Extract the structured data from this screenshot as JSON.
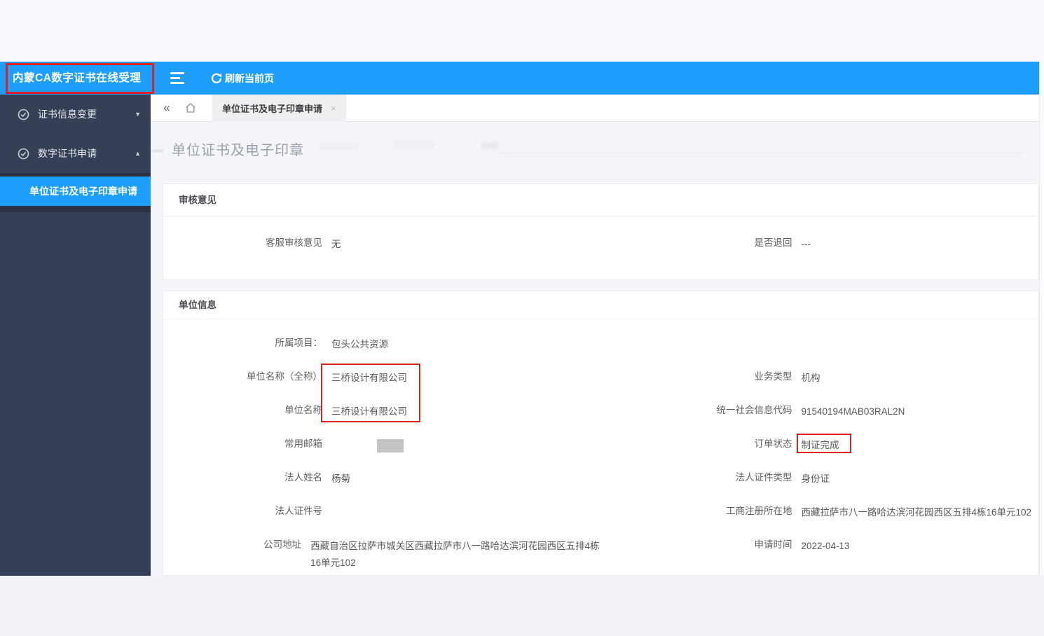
{
  "colors": {
    "accent_blue": "#1e9fff",
    "sidebar_navy": "#353f55",
    "annotation_red": "#dd2020"
  },
  "topbar": {
    "brand": "内蒙CA数字证书在线受理",
    "refresh_label": "刷新当前页"
  },
  "sidebar": {
    "items": [
      {
        "label": "证书信息变更",
        "arrow": "▼",
        "icon": "certificate-check-icon"
      },
      {
        "label": "数字证书申请",
        "arrow": "▲",
        "icon": "certificate-check-icon"
      }
    ],
    "active_subitem": "单位证书及电子印章申请"
  },
  "tabbar": {
    "collapse_glyph": "«",
    "tab_label": "单位证书及电子印章申请",
    "close_glyph": "×"
  },
  "page": {
    "title": "单位证书及电子印章"
  },
  "review_section": {
    "title": "审核意见",
    "fields": [
      {
        "label": "客服审核意见",
        "value": "无"
      },
      {
        "label": "是否退回",
        "value": "---"
      }
    ]
  },
  "unit_section": {
    "title": "单位信息",
    "rows": [
      {
        "left": {
          "label": "所属项目：",
          "value": "包头公共资源"
        },
        "right": {
          "label": "",
          "value": ""
        }
      },
      {
        "left": {
          "label": "单位名称（全称）",
          "value": "三桥设计有限公司"
        },
        "right": {
          "label": "业务类型",
          "value": "机构"
        }
      },
      {
        "left": {
          "label": "单位名称",
          "value": "三桥设计有限公司"
        },
        "right": {
          "label": "统一社会信息代码",
          "value": "91540194MAB03RAL2N"
        }
      },
      {
        "left": {
          "label": "常用邮箱",
          "value": "",
          "redacted": true
        },
        "right": {
          "label": "订单状态",
          "value": "制证完成"
        }
      },
      {
        "left": {
          "label": "法人姓名",
          "value": "杨菊"
        },
        "right": {
          "label": "法人证件类型",
          "value": "身份证"
        }
      },
      {
        "left": {
          "label": "法人证件号",
          "value": ""
        },
        "right": {
          "label": "工商注册所在地",
          "value": "西藏拉萨市八一路哈达滨河花园西区五排4栋16单元102"
        }
      },
      {
        "left": {
          "label": "公司地址",
          "value": "西藏自治区拉萨市城关区西藏拉萨市八一路哈达滨河花园西区五排4栋16单元102"
        },
        "right": {
          "label": "申请时间",
          "value": "2022-04-13"
        }
      }
    ]
  }
}
